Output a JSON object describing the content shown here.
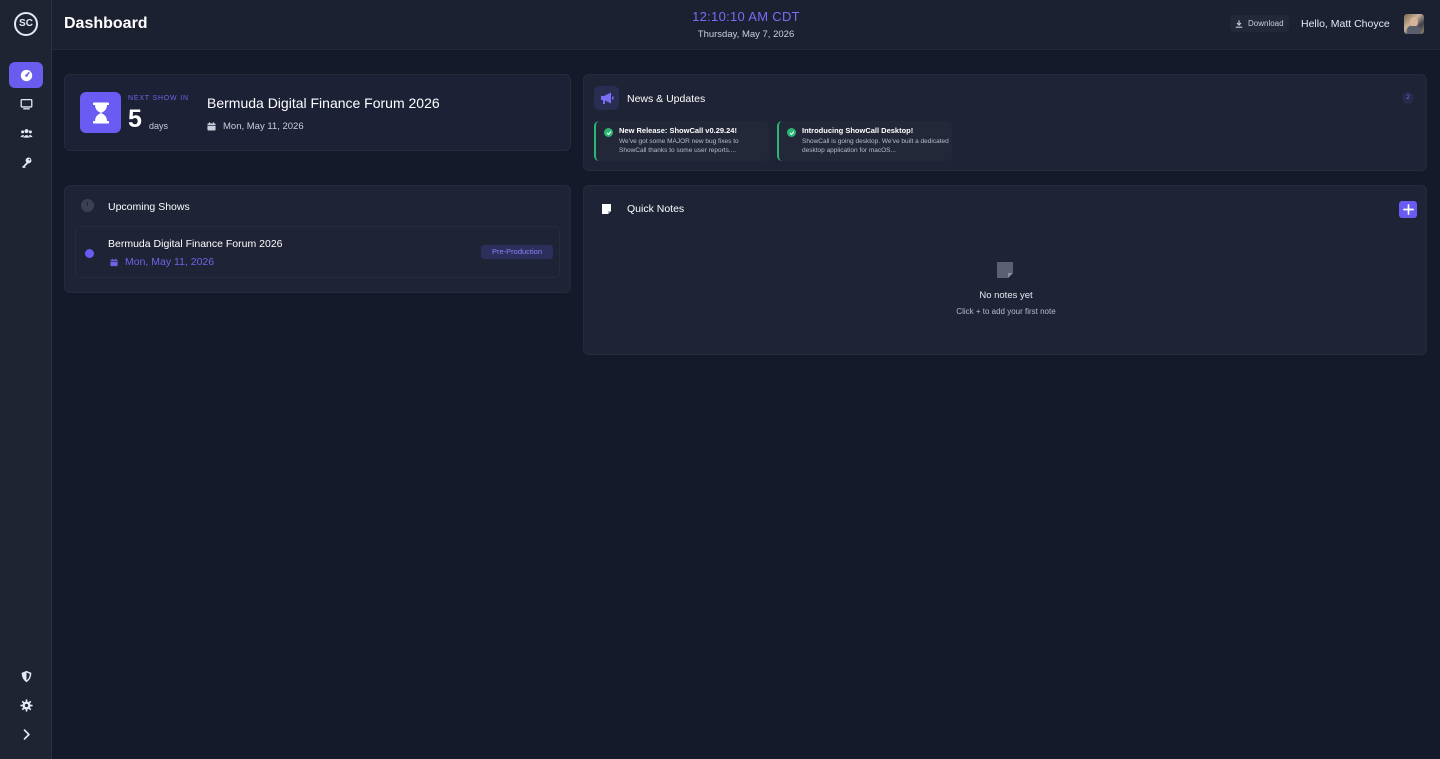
{
  "app": {
    "logo_text": "SC"
  },
  "header": {
    "title": "Dashboard",
    "clock": "12:10:10 AM CDT",
    "date": "Thursday, May 7, 2026",
    "download_label": "Download",
    "greeting": "Hello, Matt Choyce"
  },
  "sidebar": {
    "items": [
      {
        "name": "dashboard",
        "icon": "gauge-icon",
        "active": true
      },
      {
        "name": "shows",
        "icon": "monitor-icon",
        "active": false
      },
      {
        "name": "users",
        "icon": "users-icon",
        "active": false
      },
      {
        "name": "keys",
        "icon": "key-icon",
        "active": false
      }
    ],
    "bottom_items": [
      "shield-icon",
      "gear-icon",
      "chevron-right-icon"
    ]
  },
  "next_show": {
    "label": "NEXT SHOW IN",
    "count": "5",
    "unit": "days",
    "title": "Bermuda Digital Finance Forum 2026",
    "date": "Mon, May 11, 2026"
  },
  "news": {
    "title": "News & Updates",
    "count": "2",
    "items": [
      {
        "title": "New Release: ShowCall v0.29.24!",
        "body": "We've got some MAJOR new bug fixes to ShowCall thanks to some user reports...."
      },
      {
        "title": "Introducing ShowCall Desktop!",
        "body": "ShowCall is going desktop. We've built a dedicated desktop application for macOS..."
      }
    ]
  },
  "upcoming": {
    "title": "Upcoming Shows",
    "shows": [
      {
        "title": "Bermuda Digital Finance Forum 2026",
        "date": "Mon, May 11, 2026",
        "status": "Pre-Production"
      }
    ]
  },
  "notes": {
    "title": "Quick Notes",
    "empty_title": "No notes yet",
    "empty_sub": "Click + to add your first note"
  },
  "colors": {
    "accent": "#6a5cf2",
    "success": "#2bb673",
    "background": "#151a2a",
    "card": "#1e2335"
  }
}
